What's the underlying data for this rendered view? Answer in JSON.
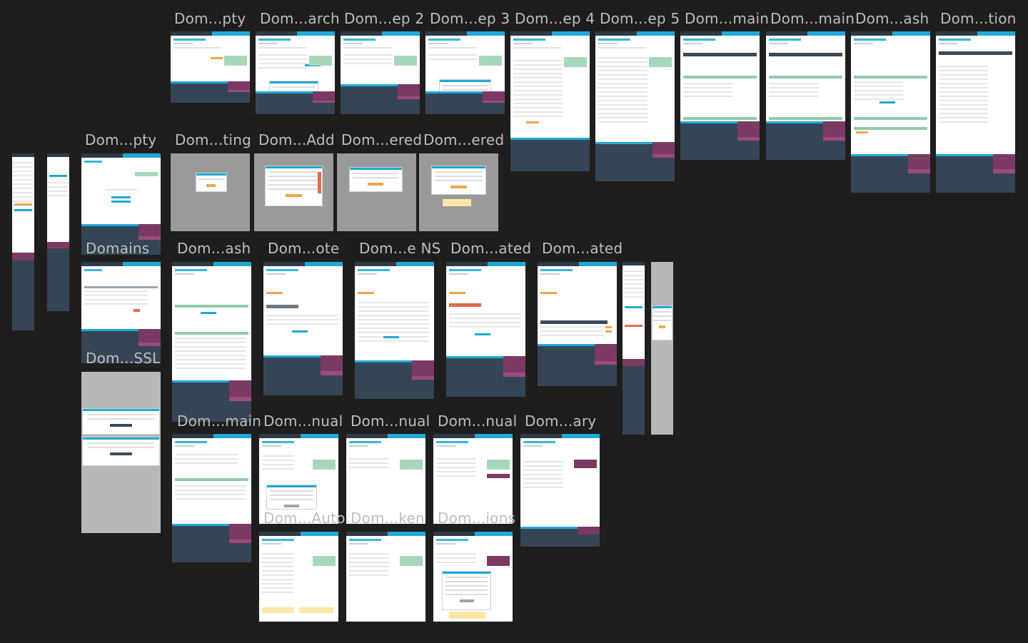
{
  "canvas": {
    "background": "#1e1e1e",
    "label_color": "#bdbdbd"
  },
  "colors": {
    "header": "#2e3a48",
    "accent": "#1fa9d6",
    "footer": "#364555",
    "promo": "#7b3a64",
    "action": "#f0a64a",
    "sidebar": "#a7d7b9"
  },
  "rows": {
    "row1": [
      "Dom...pty",
      "Dom...arch",
      "Dom...ep 2",
      "Dom...ep 3",
      "Dom...ep 4",
      "Dom...ep 5",
      "Dom...main",
      "Dom...main",
      "Dom...ash",
      "Dom...tion"
    ],
    "row2": [
      "Dom...pty",
      "Dom...ting",
      "Dom...Add",
      "Dom...ered",
      "Dom...ered"
    ],
    "row3": [
      "Domains",
      "Dom...ash",
      "Dom...ote",
      "Dom...e NS",
      "Dom...ated",
      "Dom...ated"
    ],
    "row3b": [
      "Dom...SSL"
    ],
    "row4": [
      "Dom...main",
      "Dom...nual",
      "Dom...nual",
      "Dom...nual",
      "Dom...ary"
    ],
    "row5": [
      "Dom...Auto",
      "Dom...ken",
      "Dom...ions"
    ]
  }
}
